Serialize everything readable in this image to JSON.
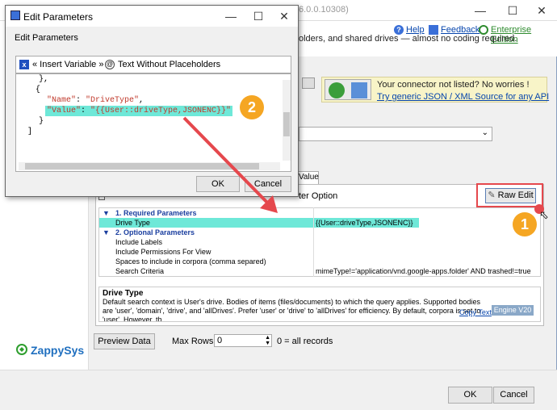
{
  "main_window": {
    "version": "6.0.0.10308)",
    "help_label": "Help",
    "feedback_label": "Feedback",
    "edition_label": "Enterprise Edition",
    "description": "olders, and shared drives — almost no coding required.",
    "banner_title": "Your connector not listed? No worries !",
    "banner_link": "Try generic JSON / XML Source for any API",
    "tab_value": "Value",
    "filter_option": "ter Option",
    "raw_edit_label": "Raw Edit",
    "grid": {
      "section1": "1. Required Parameters",
      "section2": "2. Optional Parameters",
      "rows": [
        {
          "name": "Drive Type",
          "value": "{{User::driveType,JSONENC}}"
        },
        {
          "name": "Include Labels",
          "value": ""
        },
        {
          "name": "Include Permissions For View",
          "value": ""
        },
        {
          "name": "Spaces to include in corpora (comma separed)",
          "value": ""
        },
        {
          "name": "Search Criteria",
          "value": "mimeType!='application/vnd.google-apps.folder' AND trashed!=true"
        }
      ]
    },
    "desc_title": "Drive Type",
    "desc_text": "Default search context is User's drive. Bodies of items (files/documents) to which the query applies. Supported bodies are 'user', 'domain', 'drive', and 'allDrives'. Prefer 'user' or 'drive' to 'allDrives' for efficiency. By default, corpora is set to 'user'. However, th",
    "copy_text": "Copy Text",
    "engine_label": "Engine V20",
    "preview_label": "Preview Data",
    "max_rows_label": "Max Rows:",
    "max_rows_value": "0",
    "max_rows_hint": "0 = all records",
    "ok_label": "OK",
    "cancel_label": "Cancel",
    "logo_text": "ZappySys"
  },
  "dialog": {
    "title": "Edit Parameters",
    "subtitle": "Edit Parameters",
    "insert_variable": "« Insert Variable »",
    "text_without_placeholders": "Text Without Placeholders",
    "code": {
      "line1": "},",
      "line2": "{",
      "line3_key": "\"Name\"",
      "line3_rest": ": ",
      "line3_val": "\"DriveType\"",
      "line3_end": ",",
      "line4_key": "\"Value\"",
      "line4_rest": ": ",
      "line4_val": "\"{{User::driveType,JSONENC}}\"",
      "line5": "}",
      "line6": "]"
    },
    "ok_label": "OK",
    "cancel_label": "Cancel"
  },
  "annotations": {
    "badge1": "1",
    "badge2": "2"
  },
  "colors": {
    "highlight": "#6ee8d8",
    "badge": "#f5a623",
    "arrow": "#e5484d"
  }
}
